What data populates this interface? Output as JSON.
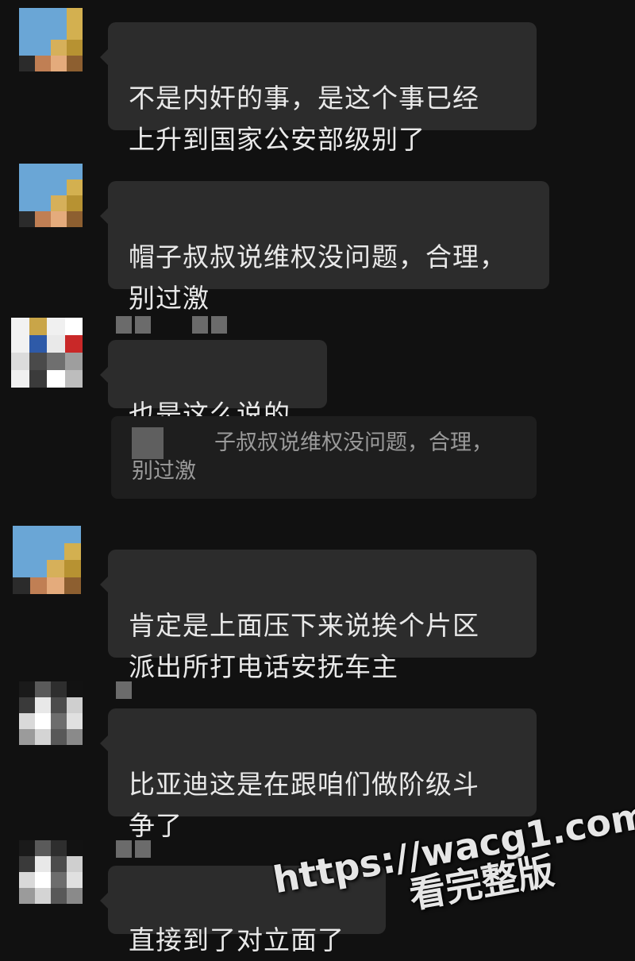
{
  "messages": [
    {
      "text": "不是内奸的事，是这个事已经\n上升到国家公安部级别了"
    },
    {
      "text": "帽子叔叔说维权没问题，合理，\n别过激"
    },
    {
      "text": "也是这么说的",
      "quote": "子叔叔说维权没问题，合理，",
      "quote_line2": "别过激"
    },
    {
      "text": "肯定是上面压下来说挨个片区\n派出所打电话安抚车主"
    },
    {
      "text": "比亚迪这是在跟咱们做阶级斗\n争了"
    },
    {
      "text": "直接到了对立面了"
    }
  ],
  "watermark": {
    "url": "https://wacg1.com",
    "caption": "看完整版"
  },
  "colors": {
    "background": "#111111",
    "bubble": "#2c2c2c",
    "text": "#e9e9e9"
  }
}
